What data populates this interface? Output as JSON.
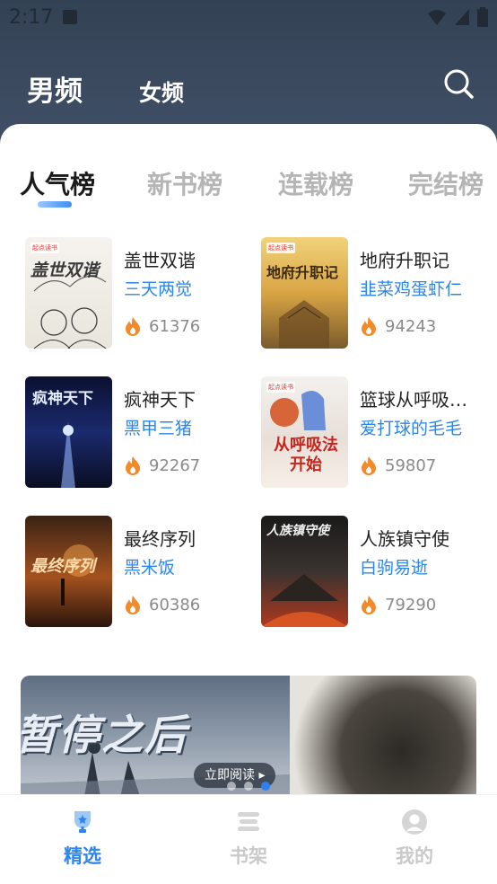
{
  "status": {
    "time": "2:17"
  },
  "header": {
    "channels": [
      {
        "label": "男频",
        "active": true
      },
      {
        "label": "女频",
        "active": false
      }
    ],
    "search_icon": "search-icon"
  },
  "rank_tabs": [
    {
      "label": "人气榜",
      "active": true
    },
    {
      "label": "新书榜",
      "active": false
    },
    {
      "label": "连载榜",
      "active": false
    },
    {
      "label": "完结榜",
      "active": false
    }
  ],
  "books": [
    {
      "title": "盖世双谐",
      "author": "三天两觉",
      "heat": "61376",
      "cover_text": "盖世双谐"
    },
    {
      "title": "地府升职记",
      "author": "韭菜鸡蛋虾仁",
      "heat": "94243",
      "cover_text": "地府升职记"
    },
    {
      "title": "疯神天下",
      "author": "黑甲三猪",
      "heat": "92267",
      "cover_text": "疯神天下"
    },
    {
      "title": "篮球从呼吸…",
      "author": "爱打球的毛毛",
      "heat": "59807",
      "cover_text": "从呼吸法开始"
    },
    {
      "title": "最终序列",
      "author": "黑米饭",
      "heat": "60386",
      "cover_text": "最终序列"
    },
    {
      "title": "人族镇守使",
      "author": "白驹易逝",
      "heat": "79290",
      "cover_text": "人族镇守使"
    }
  ],
  "banner": {
    "title": "暂停之后",
    "button_label": "立即阅读 ▸",
    "dots": 3,
    "active_dot": 2
  },
  "bottom_nav": [
    {
      "label": "精选",
      "icon": "trophy-icon",
      "active": true
    },
    {
      "label": "书架",
      "icon": "bookshelf-icon",
      "active": false
    },
    {
      "label": "我的",
      "icon": "profile-icon",
      "active": false
    }
  ],
  "colors": {
    "accent": "#2f86ea",
    "author": "#2c86e8",
    "header_bg": "#364559"
  }
}
